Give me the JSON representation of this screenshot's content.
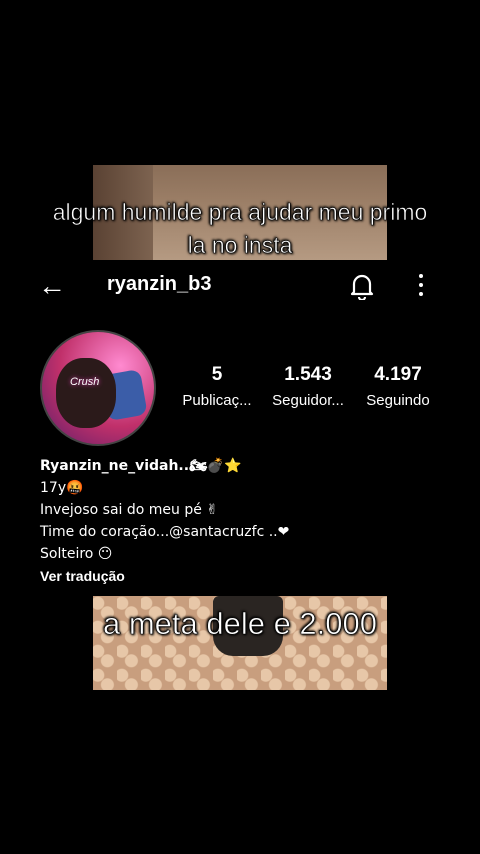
{
  "captions": {
    "top_line1": "algum humilde pra ajudar meu primo",
    "top_line2": "la no insta",
    "bottom": "a meta dele e 2.000"
  },
  "header": {
    "back_icon": "arrow-left-icon",
    "username": "ryanzin_b3",
    "bell_icon": "bell-icon",
    "more_icon": "more-vertical-icon"
  },
  "avatar": {
    "overlay_text": "Crush"
  },
  "stats": [
    {
      "value": "5",
      "label": "Publicaç..."
    },
    {
      "value": "1.543",
      "label": "Seguidor..."
    },
    {
      "value": "4.197",
      "label": "Seguindo"
    }
  ],
  "bio": {
    "name": "Ryanzin_ne_vidah..🏍💣⭐",
    "line1": "17y🤬",
    "line2": "Invejoso sai do meu pé ✌",
    "line3": "Time do coração...@santacruzfc ..❤",
    "line4": "Solteiro 😶",
    "translate": "Ver tradução"
  }
}
